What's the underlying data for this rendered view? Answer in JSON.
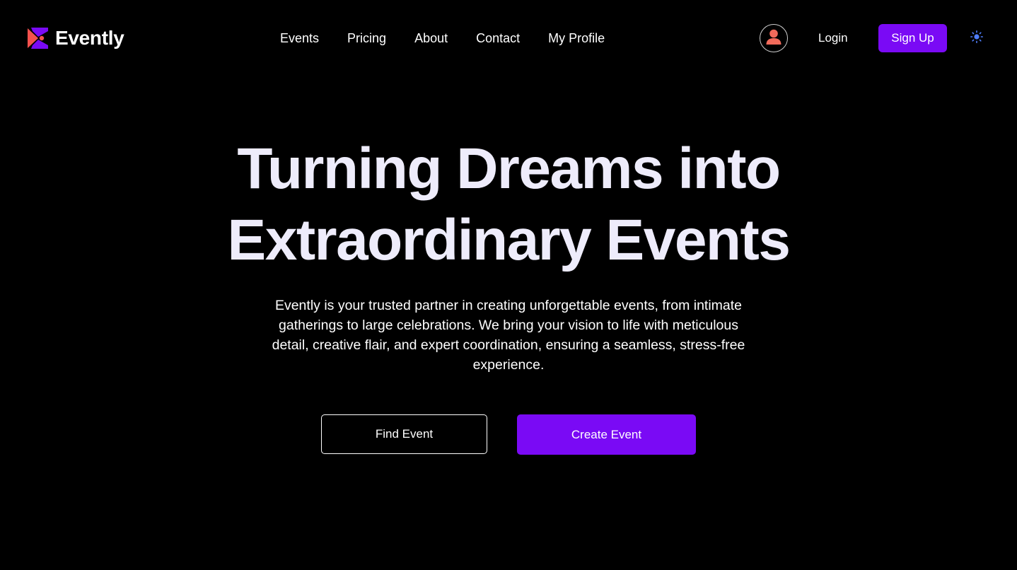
{
  "header": {
    "brand": "Evently",
    "logo_icon": "evently-logo-icon",
    "nav": [
      {
        "label": "Events"
      },
      {
        "label": "Pricing"
      },
      {
        "label": "About"
      },
      {
        "label": "Contact"
      },
      {
        "label": "My Profile"
      }
    ],
    "avatar_icon": "user-avatar-icon",
    "login_label": "Login",
    "signup_label": "Sign Up",
    "theme_icon": "sun-icon"
  },
  "hero": {
    "title_line1": "Turning Dreams into",
    "title_line2": "Extraordinary Events",
    "description": "Evently is your trusted partner in creating unforgettable events, from intimate gatherings to large celebrations. We bring your vision to life with meticulous detail, creative flair, and expert coordination, ensuring a seamless, stress-free experience.",
    "find_button": "Find Event",
    "create_button": "Create Event"
  },
  "colors": {
    "background": "#000000",
    "accent": "#7a0af5",
    "title": "#eeecfb",
    "avatar": "#f26b5b",
    "logo_red": "#f5514d",
    "logo_purple": "#7a0af5",
    "sun": "#4f7dfc"
  }
}
